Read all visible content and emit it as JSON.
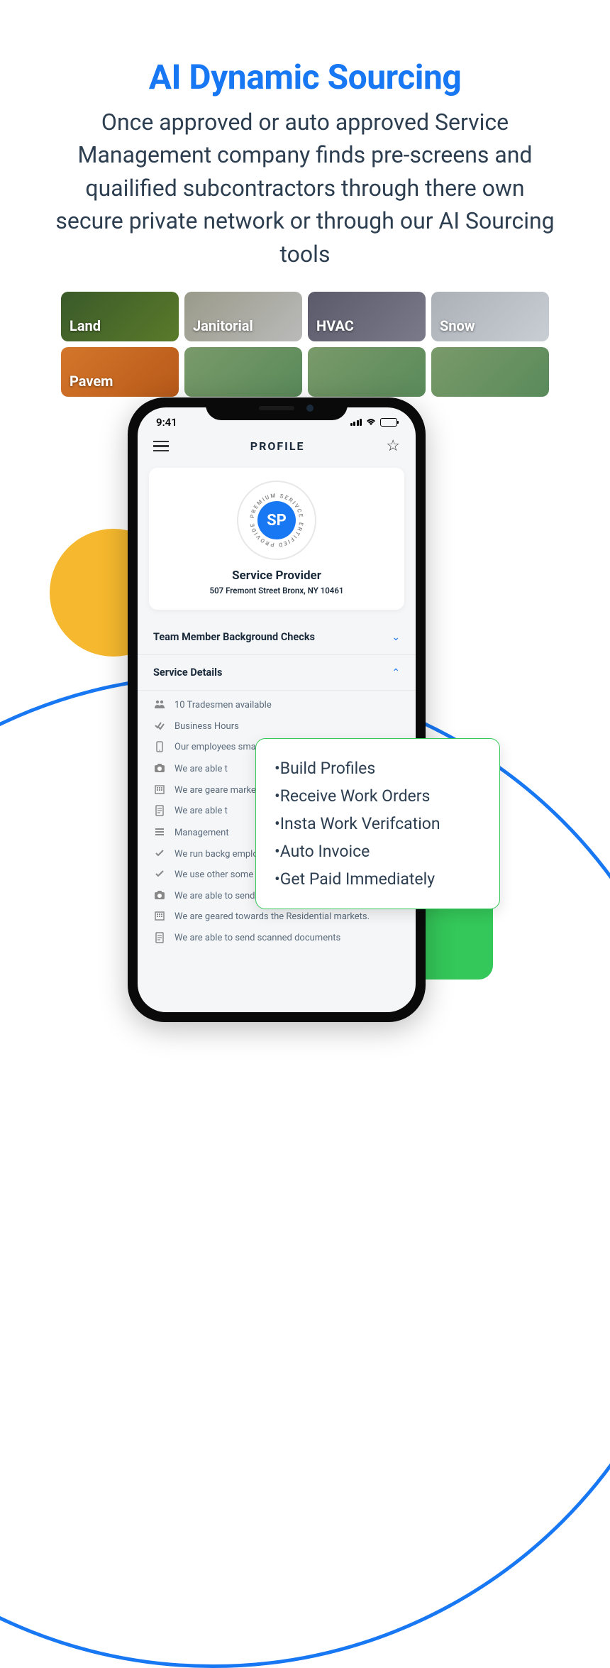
{
  "hero": {
    "title": "AI Dynamic Sourcing",
    "description": "Once approved or auto approved Service Management company finds pre-screens and quailified subcontractors through there own secure private network or through our AI Sourcing tools"
  },
  "categories": [
    {
      "label": "Land",
      "cls": "land"
    },
    {
      "label": "Janitorial",
      "cls": "janitorial"
    },
    {
      "label": "HVAC",
      "cls": "hvac"
    },
    {
      "label": "Snow",
      "cls": "snow"
    },
    {
      "label": "Pavem",
      "cls": "pavement"
    },
    {
      "label": "",
      "cls": "generic"
    },
    {
      "label": "",
      "cls": "generic"
    },
    {
      "label": "",
      "cls": "generic"
    }
  ],
  "phone": {
    "status_time": "9:41",
    "header_title": "PROFILE",
    "badge_initials": "SP",
    "badge_ring_top": "PREMIUM SERIVCE",
    "badge_ring_bottom": "CERTIFIED PROVIDER",
    "provider_name": "Service Provider",
    "provider_address": "507 Fremont Street Bronx, NY 10461",
    "section1": "Team Member Background Checks",
    "section2": "Service Details",
    "details": [
      {
        "icon": "people",
        "text": "10 Tradesmen available"
      },
      {
        "icon": "check2",
        "text": "Business Hours"
      },
      {
        "icon": "phone",
        "text": "Our employees smartphones"
      },
      {
        "icon": "camera",
        "text": "We are able t"
      },
      {
        "icon": "building",
        "text": "We are geare markets."
      },
      {
        "icon": "doc",
        "text": "We are able t"
      },
      {
        "icon": "list",
        "text": "Management"
      },
      {
        "icon": "check",
        "text": "We run backg employees"
      },
      {
        "icon": "check",
        "text": "We use other some of our work orders"
      },
      {
        "icon": "camera",
        "text": "We are able to send pictures of job sites"
      },
      {
        "icon": "building",
        "text": "We are geared towards the Residential markets."
      },
      {
        "icon": "doc",
        "text": "We are able to send scanned documents"
      }
    ]
  },
  "popup": [
    "•Build Profiles",
    "•Receive Work Orders",
    "•Insta Work Verifcation",
    "•Auto Invoice",
    "•Get Paid Immediately"
  ]
}
